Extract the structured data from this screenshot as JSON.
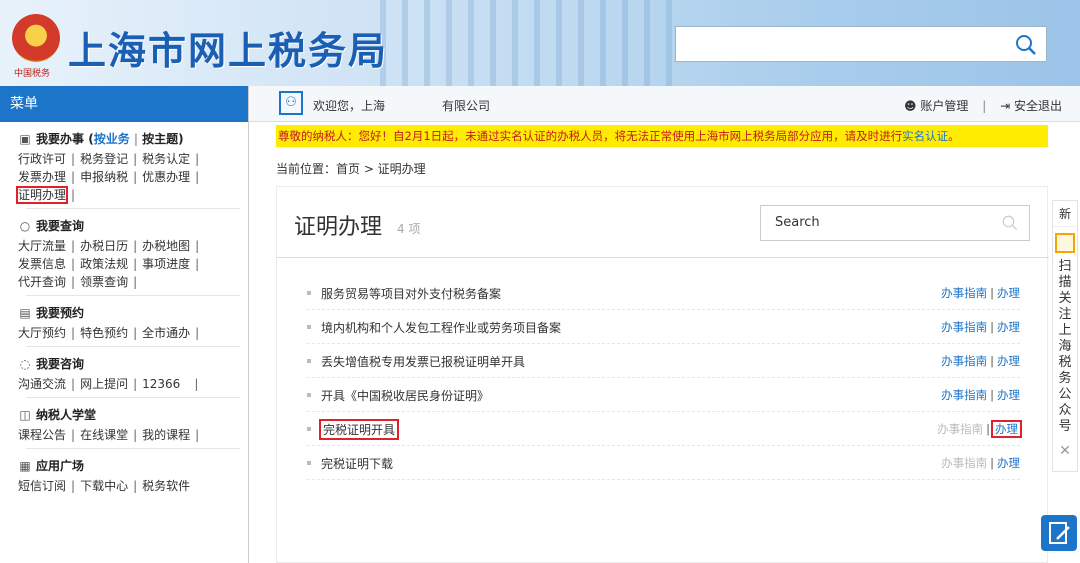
{
  "header": {
    "emblem_caption": "中国税务",
    "site_title": "上海市网上税务局",
    "search_placeholder": ""
  },
  "sidebar": {
    "menu_label": "菜单",
    "sections": [
      {
        "title": "我要办事",
        "tab_business": "按业务",
        "tab_topic": "按主题",
        "lines": [
          [
            "行政许可",
            "税务登记",
            "税务认定"
          ],
          [
            "发票办理",
            "申报纳税",
            "优惠办理"
          ],
          [
            "证明办理"
          ]
        ]
      },
      {
        "title": "我要查询",
        "lines": [
          [
            "大厅流量",
            "办税日历",
            "办税地图"
          ],
          [
            "发票信息",
            "政策法规",
            "事项进度"
          ],
          [
            "代开查询",
            "领票查询"
          ]
        ]
      },
      {
        "title": "我要预约",
        "lines": [
          [
            "大厅预约",
            "特色预约",
            "全市通办"
          ]
        ]
      },
      {
        "title": "我要咨询",
        "lines": [
          [
            "沟通交流",
            "网上提问",
            "12366"
          ]
        ]
      },
      {
        "title": "纳税人学堂",
        "lines": [
          [
            "课程公告",
            "在线课堂",
            "我的课程"
          ]
        ]
      },
      {
        "title": "应用广场",
        "lines": [
          [
            "短信订阅",
            "下载中心",
            "税务软件"
          ]
        ]
      }
    ]
  },
  "topbar": {
    "welcome": "欢迎您，上海",
    "company": "有限公司",
    "account_manage": "账户管理",
    "logout": "安全退出"
  },
  "notice": {
    "text": "尊敬的纳税人：您好！自2月1日起，未通过实名认证的办税人员，将无法正常使用上海市网上税务局部分应用，请及时进行",
    "link": "实名认证",
    "end": "。"
  },
  "breadcrumb": "当前位置：首页 > 证明办理",
  "panel": {
    "title": "证明办理",
    "count": "4 项",
    "search_placeholder": "Search",
    "guide_label": "办事指南",
    "action_label": "办理",
    "items": [
      "服务贸易等项目对外支付税务备案",
      "境内机构和个人发包工程作业或劳务项目备案",
      "丢失增值税专用发票已报税证明单开具",
      "开具《中国税收居民身份证明》",
      "完税证明开具",
      "完税证明下载"
    ]
  },
  "float": {
    "new_label": "新",
    "scan_text": "扫描关注上海税务公众号"
  },
  "colors": {
    "brand_blue": "#1d75c9",
    "notice_bg": "#ffec00",
    "notice_text": "#c6181e",
    "highlight_red": "#e0232a"
  }
}
